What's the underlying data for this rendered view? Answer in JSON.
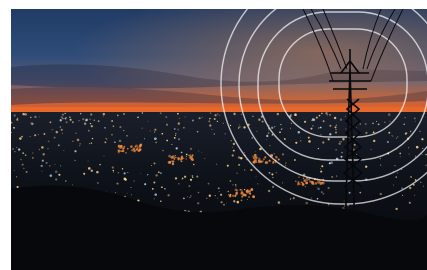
{
  "image": {
    "subject": "night-city-power-transmission-tower",
    "palette": {
      "sky_top": "#1f3b66",
      "sky_mid": "#33507a",
      "horizon_orange": "#e4602a",
      "horizon_glow": "#f08a3c",
      "city_dark": "#0c0f16",
      "city_lights": "#ffd38a",
      "city_lights_cool": "#c9e3ff",
      "hills": "#07090d",
      "rings": "#ffffff"
    }
  }
}
